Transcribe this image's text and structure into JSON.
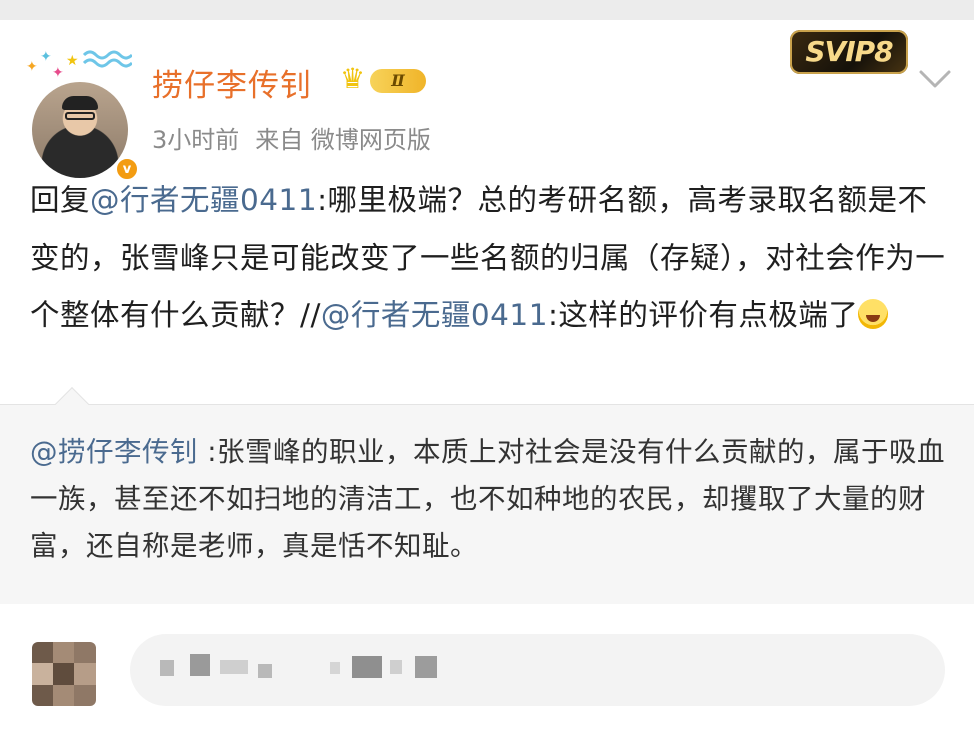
{
  "post": {
    "username": "捞仔李传钊",
    "level_badge": "Ⅱ",
    "verified_badge": "v",
    "svip_label": "SVIP8",
    "time": "3小时前",
    "source": "来自 微博网页版",
    "content": {
      "reply_prefix": "回复",
      "mention_1": "@行者无疆0411",
      "text_1": ":哪里极端？总的考研名额，高考录取名额是不变的，张雪峰只是可能改变了一些名额的归属（存疑），对社会作为一个整体有什么贡献？//",
      "mention_2": "@行者无疆0411",
      "text_2": ":这样的评价有点极端了"
    }
  },
  "quote": {
    "mention": "@捞仔李传钊",
    "text": " :张雪峰的职业，本质上对社会是没有什么贡献的，属于吸血一族，甚至还不如扫地的清洁工，也不如种地的农民，却攫取了大量的财富，还自称是老师，真是恬不知耻。"
  },
  "colors": {
    "username": "#e8702a",
    "mention": "#4a6a8f",
    "meta": "#8a8a8a"
  },
  "icons": {
    "more": "chevron-down-icon",
    "crown": "crown-icon",
    "emoji": "laugh-cry-emoji-icon"
  }
}
